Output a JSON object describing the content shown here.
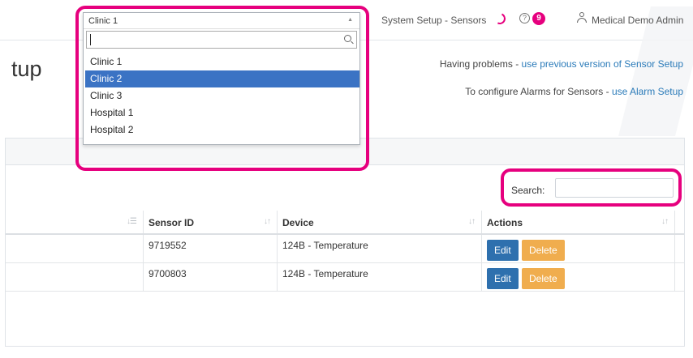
{
  "topbar": {
    "breadcrumb": "System Setup - Sensors",
    "notifications_count": "9",
    "user_name": "Medical Demo Admin"
  },
  "page": {
    "title_fragment": "tup",
    "help_line_1_prefix": "Having problems - ",
    "help_line_1_link": "use previous version of Sensor Setup",
    "help_line_2_prefix": "To configure Alarms for Sensors - ",
    "help_line_2_link": "use Alarm Setup"
  },
  "dropdown": {
    "selected": "Clinic 1",
    "search_value": "",
    "options": [
      {
        "label": "Clinic 1",
        "active": false
      },
      {
        "label": "Clinic 2",
        "active": true
      },
      {
        "label": "Clinic 3",
        "active": false
      },
      {
        "label": "Hospital 1",
        "active": false
      },
      {
        "label": "Hospital 2",
        "active": false
      }
    ]
  },
  "search": {
    "label": "Search:",
    "value": ""
  },
  "table": {
    "columns": [
      "Sensor ID",
      "Device",
      "Actions"
    ],
    "rows": [
      {
        "sensor_id": "9719552",
        "device": "124B - Temperature",
        "edit": "Edit",
        "delete": "Delete"
      },
      {
        "sensor_id": "9700803",
        "device": "124B - Temperature",
        "edit": "Edit",
        "delete": "Delete"
      }
    ]
  },
  "colors": {
    "highlight": "#e6007e",
    "edit_button": "#2e70ae",
    "delete_button": "#f0ad4e",
    "link": "#2b7bb9",
    "active_option": "#3b73c4"
  }
}
